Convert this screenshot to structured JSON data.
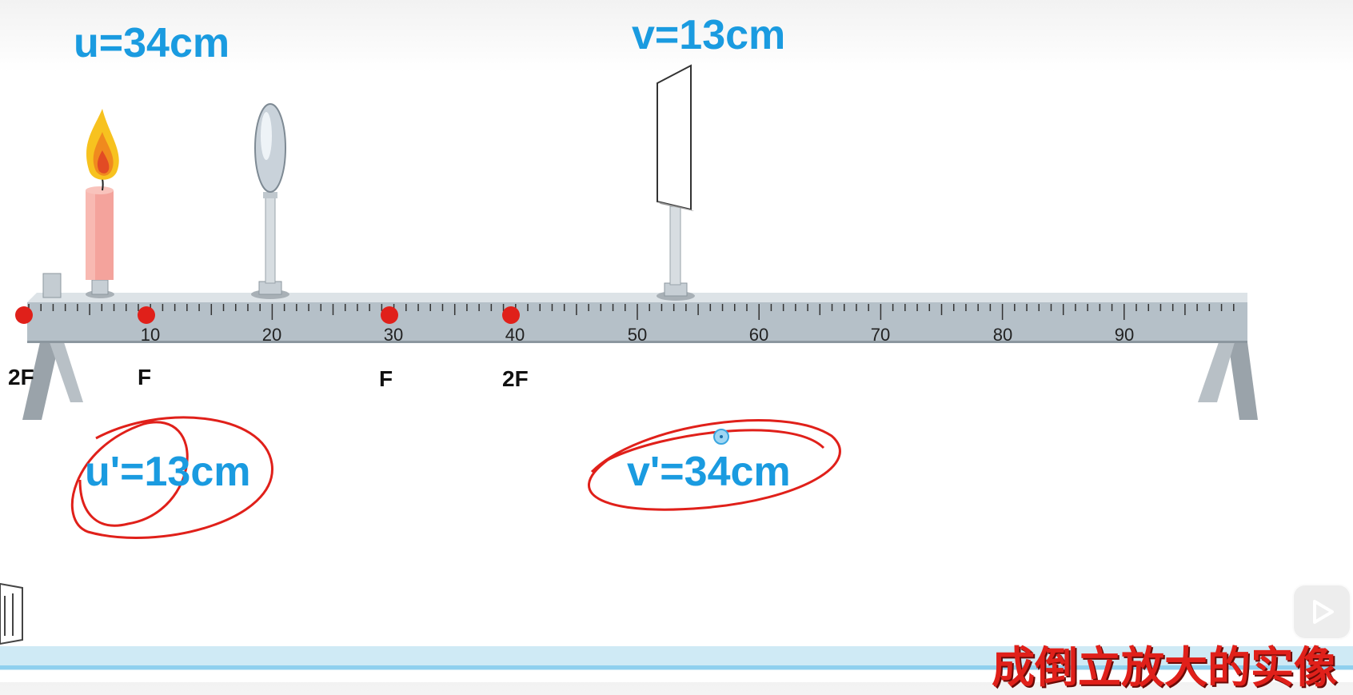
{
  "labels": {
    "u": "u=34cm",
    "v": "v=13cm",
    "u_prime": "u'=13cm",
    "v_prime": "v'=34cm"
  },
  "bench": {
    "tick_labels": [
      "10",
      "20",
      "30",
      "40",
      "50",
      "60",
      "70",
      "80",
      "90"
    ]
  },
  "focal_points": [
    "2F",
    "F",
    "F",
    "2F"
  ],
  "conclusion": "成倒立放大的实像",
  "colors": {
    "label_blue": "#1a9be0",
    "annotation_red": "#e0201a",
    "bench_gray": "#b5c0c8"
  },
  "icons": {
    "play": "play-icon"
  }
}
